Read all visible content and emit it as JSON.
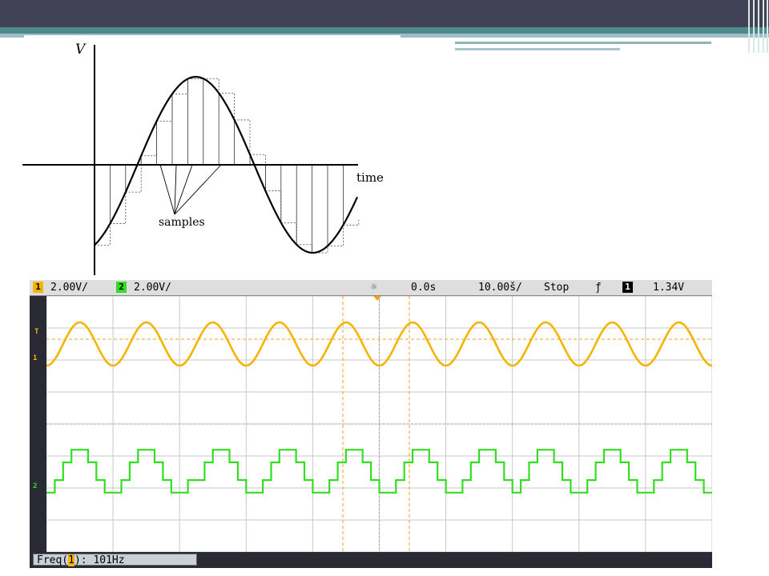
{
  "diagram": {
    "axis_v_label": "V",
    "axis_time_label": "time",
    "samples_label": "samples"
  },
  "scope": {
    "ch1_number": "1",
    "ch1_scale": "2.00V/",
    "ch2_number": "2",
    "ch2_scale": "2.00V/",
    "time_offset": "0.0s",
    "time_scale": "10.00š/",
    "run_state": "Stop",
    "trigger_slope": "ƒ",
    "trigger_channel": "1",
    "trigger_level": "1.34V",
    "trigger_marker": "T",
    "ch1_marker": "1",
    "ch2_marker": "2",
    "measurement_prefix": "Freq(",
    "measurement_channel": "1",
    "measurement_value": "): 101Hz",
    "colors": {
      "ch1": "#f5b400",
      "ch2": "#33dd22",
      "grid": "#c8c8c8",
      "cursor": "#f5a020",
      "header_bar": "#424257",
      "accent": "#4d8a8c"
    }
  }
}
